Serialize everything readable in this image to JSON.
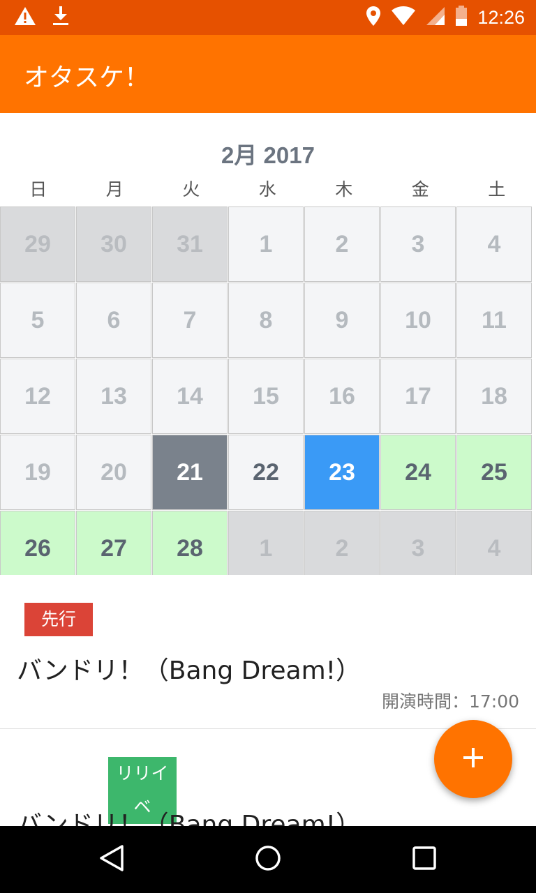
{
  "status_bar": {
    "time": "12:26",
    "left_icons": [
      "warning-icon",
      "download-icon"
    ],
    "right_icons": [
      "location-icon",
      "wifi-icon",
      "signal-icon",
      "battery-icon"
    ]
  },
  "app_bar": {
    "title": "オタスケ！"
  },
  "calendar": {
    "month_title": "2月 2017",
    "weekdays": [
      "日",
      "月",
      "火",
      "水",
      "木",
      "金",
      "土"
    ],
    "rows": [
      [
        {
          "day": "29",
          "state": "other"
        },
        {
          "day": "30",
          "state": "other"
        },
        {
          "day": "31",
          "state": "other"
        },
        {
          "day": "1",
          "state": "past"
        },
        {
          "day": "2",
          "state": "past"
        },
        {
          "day": "3",
          "state": "past"
        },
        {
          "day": "4",
          "state": "past"
        }
      ],
      [
        {
          "day": "5",
          "state": "past"
        },
        {
          "day": "6",
          "state": "past"
        },
        {
          "day": "7",
          "state": "past"
        },
        {
          "day": "8",
          "state": "past"
        },
        {
          "day": "9",
          "state": "past"
        },
        {
          "day": "10",
          "state": "past"
        },
        {
          "day": "11",
          "state": "past"
        }
      ],
      [
        {
          "day": "12",
          "state": "past"
        },
        {
          "day": "13",
          "state": "past"
        },
        {
          "day": "14",
          "state": "past"
        },
        {
          "day": "15",
          "state": "past"
        },
        {
          "day": "16",
          "state": "past"
        },
        {
          "day": "17",
          "state": "past"
        },
        {
          "day": "18",
          "state": "past"
        }
      ],
      [
        {
          "day": "19",
          "state": "past"
        },
        {
          "day": "20",
          "state": "past"
        },
        {
          "day": "21",
          "state": "today"
        },
        {
          "day": "22",
          "state": "normal"
        },
        {
          "day": "23",
          "state": "selected"
        },
        {
          "day": "24",
          "state": "event"
        },
        {
          "day": "25",
          "state": "event"
        }
      ],
      [
        {
          "day": "26",
          "state": "event"
        },
        {
          "day": "27",
          "state": "event"
        },
        {
          "day": "28",
          "state": "event"
        },
        {
          "day": "1",
          "state": "other"
        },
        {
          "day": "2",
          "state": "other"
        },
        {
          "day": "3",
          "state": "other"
        },
        {
          "day": "4",
          "state": "other"
        }
      ]
    ]
  },
  "events": [
    {
      "badge": "先行",
      "badge_color": "#DB4437",
      "title": "バンドリ！（Bang Dream!）",
      "time_label": "開演時間：17:00"
    },
    {
      "badge": "リリイベ",
      "badge_color": "#3DB76C",
      "title": "バンドリ！（Bang Dream!）",
      "time_label": ""
    }
  ],
  "fab": {
    "icon": "plus-icon"
  },
  "nav_bar": {
    "icons": [
      "back-icon",
      "home-icon",
      "recents-icon"
    ]
  },
  "colors": {
    "status_bar": "#E65100",
    "app_bar": "#FF7300",
    "today": "#7A828C",
    "selected": "#3A9AF6",
    "event_day": "#CCFACB"
  }
}
